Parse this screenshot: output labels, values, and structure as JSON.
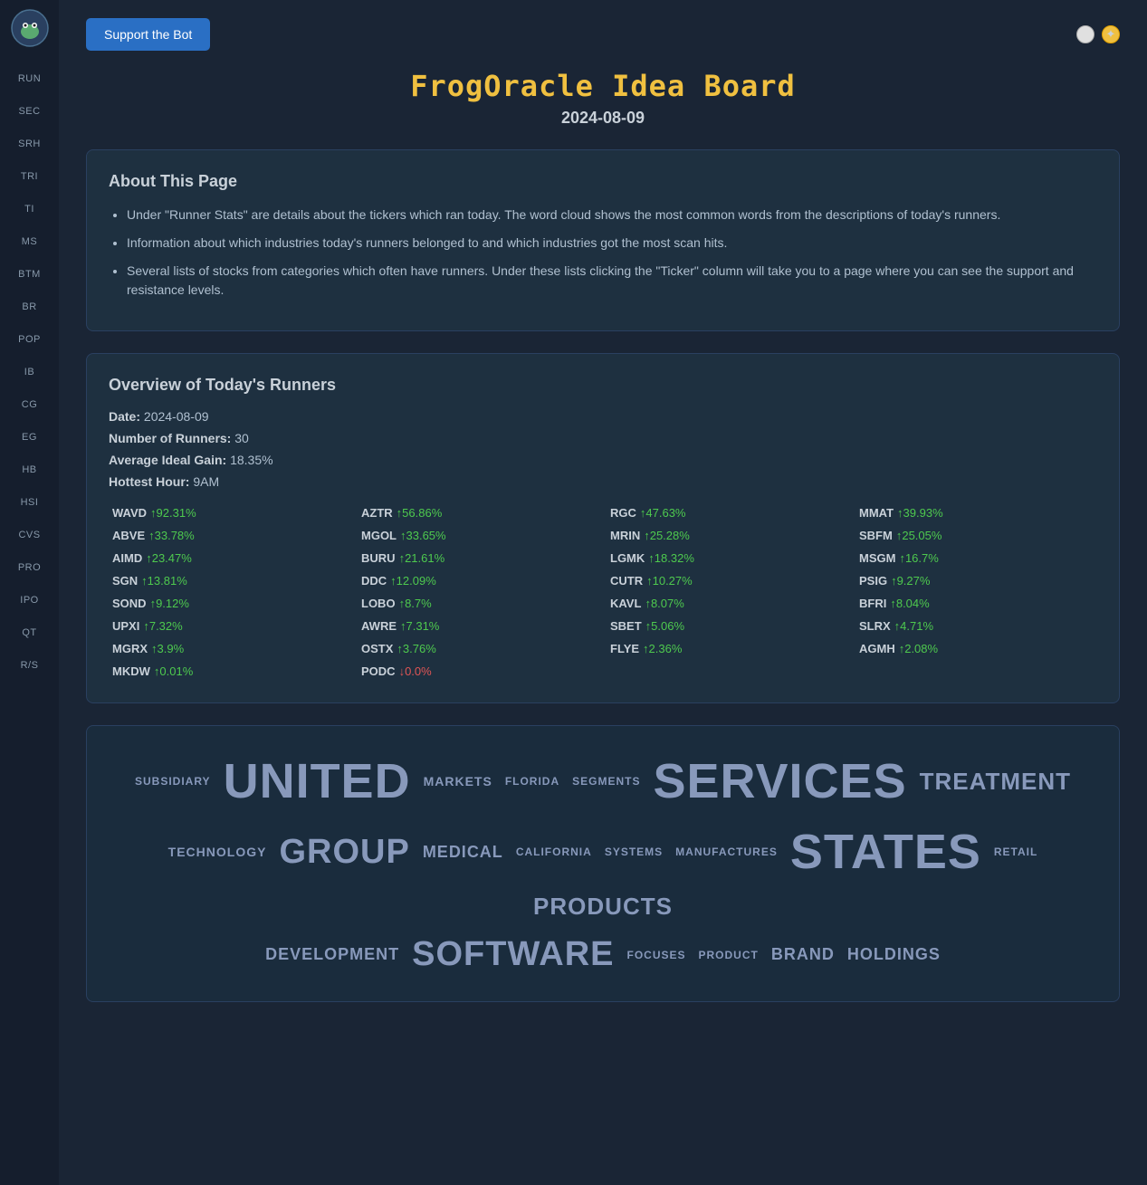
{
  "sidebar": {
    "items": [
      {
        "label": "RUN"
      },
      {
        "label": "SEC"
      },
      {
        "label": "SRH"
      },
      {
        "label": "TRI"
      },
      {
        "label": "TI"
      },
      {
        "label": "MS"
      },
      {
        "label": "BTM"
      },
      {
        "label": "BR"
      },
      {
        "label": "POP"
      },
      {
        "label": "IB"
      },
      {
        "label": "CG"
      },
      {
        "label": "EG"
      },
      {
        "label": "HB"
      },
      {
        "label": "HSI"
      },
      {
        "label": "CVS"
      },
      {
        "label": "PRO"
      },
      {
        "label": "IPO"
      },
      {
        "label": "QT"
      },
      {
        "label": "R/S"
      }
    ]
  },
  "topbar": {
    "support_btn": "Support the Bot"
  },
  "page": {
    "title": "FrogOracle Idea Board",
    "date": "2024-08-09"
  },
  "about": {
    "card_title": "About This Page",
    "bullets": [
      "Under \"Runner Stats\" are details about the tickers which ran today. The word cloud shows the most common words from the descriptions of today's runners.",
      "Information about which industries today's runners belonged to and which industries got the most scan hits.",
      "Several lists of stocks from categories which often have runners. Under these lists clicking the \"Ticker\" column will take you to a page where you can see the support and resistance levels."
    ]
  },
  "overview": {
    "card_title": "Overview of Today's Runners",
    "date_label": "Date:",
    "date_value": "2024-08-09",
    "runners_label": "Number of Runners:",
    "runners_value": "30",
    "gain_label": "Average Ideal Gain:",
    "gain_value": "18.35%",
    "hour_label": "Hottest Hour:",
    "hour_value": "9AM",
    "runners": [
      {
        "ticker": "WAVD",
        "gain": "↑92.31%",
        "up": true
      },
      {
        "ticker": "AZTR",
        "gain": "↑56.86%",
        "up": true
      },
      {
        "ticker": "RGC",
        "gain": "↑47.63%",
        "up": true
      },
      {
        "ticker": "MMAT",
        "gain": "↑39.93%",
        "up": true
      },
      {
        "ticker": "ABVE",
        "gain": "↑33.78%",
        "up": true
      },
      {
        "ticker": "MGOL",
        "gain": "↑33.65%",
        "up": true
      },
      {
        "ticker": "MRIN",
        "gain": "↑25.28%",
        "up": true
      },
      {
        "ticker": "SBFM",
        "gain": "↑25.05%",
        "up": true
      },
      {
        "ticker": "AIMD",
        "gain": "↑23.47%",
        "up": true
      },
      {
        "ticker": "BURU",
        "gain": "↑21.61%",
        "up": true
      },
      {
        "ticker": "LGMK",
        "gain": "↑18.32%",
        "up": true
      },
      {
        "ticker": "MSGM",
        "gain": "↑16.7%",
        "up": true
      },
      {
        "ticker": "SGN",
        "gain": "↑13.81%",
        "up": true
      },
      {
        "ticker": "DDC",
        "gain": "↑12.09%",
        "up": true
      },
      {
        "ticker": "CUTR",
        "gain": "↑10.27%",
        "up": true
      },
      {
        "ticker": "PSIG",
        "gain": "↑9.27%",
        "up": true
      },
      {
        "ticker": "SOND",
        "gain": "↑9.12%",
        "up": true
      },
      {
        "ticker": "LOBO",
        "gain": "↑8.7%",
        "up": true
      },
      {
        "ticker": "KAVL",
        "gain": "↑8.07%",
        "up": true
      },
      {
        "ticker": "BFRI",
        "gain": "↑8.04%",
        "up": true
      },
      {
        "ticker": "UPXI",
        "gain": "↑7.32%",
        "up": true
      },
      {
        "ticker": "AWRE",
        "gain": "↑7.31%",
        "up": true
      },
      {
        "ticker": "SBET",
        "gain": "↑5.06%",
        "up": true
      },
      {
        "ticker": "SLRX",
        "gain": "↑4.71%",
        "up": true
      },
      {
        "ticker": "MGRX",
        "gain": "↑3.9%",
        "up": true
      },
      {
        "ticker": "OSTX",
        "gain": "↑3.76%",
        "up": true
      },
      {
        "ticker": "FLYE",
        "gain": "↑2.36%",
        "up": true
      },
      {
        "ticker": "AGMH",
        "gain": "↑2.08%",
        "up": true
      },
      {
        "ticker": "MKDW",
        "gain": "↑0.01%",
        "up": true
      },
      {
        "ticker": "PODC",
        "gain": "↓0.0%",
        "up": false
      }
    ]
  },
  "wordcloud": {
    "rows": [
      [
        {
          "word": "SUBSIDIARY",
          "size": "xs"
        },
        {
          "word": "UNITED",
          "size": "xxl"
        },
        {
          "word": "MARKETS",
          "size": "sm"
        },
        {
          "word": "FLORIDA",
          "size": "xs"
        },
        {
          "word": "SEGMENTS",
          "size": "xs"
        },
        {
          "word": "SERVICES",
          "size": "xxl"
        },
        {
          "word": "TREATMENT",
          "size": "lg"
        }
      ],
      [
        {
          "word": "TECHNOLOGY",
          "size": "sm"
        },
        {
          "word": "GROUP",
          "size": "xl"
        },
        {
          "word": "MEDICAL",
          "size": "md"
        },
        {
          "word": "CALIFORNIA",
          "size": "xs"
        },
        {
          "word": "SYSTEMS",
          "size": "xs"
        },
        {
          "word": "MANUFACTURES",
          "size": "xs"
        },
        {
          "word": "STATES",
          "size": "xxl"
        },
        {
          "word": "RETAIL",
          "size": "xs"
        },
        {
          "word": "PRODUCTS",
          "size": "lg"
        }
      ],
      [
        {
          "word": "DEVELOPMENT",
          "size": "md"
        },
        {
          "word": "SOFTWARE",
          "size": "xl"
        },
        {
          "word": "FOCUSES",
          "size": "xs"
        },
        {
          "word": "PRODUCT",
          "size": "xs"
        },
        {
          "word": "BRAND",
          "size": "md"
        },
        {
          "word": "HOLDINGS",
          "size": "md"
        }
      ]
    ]
  }
}
